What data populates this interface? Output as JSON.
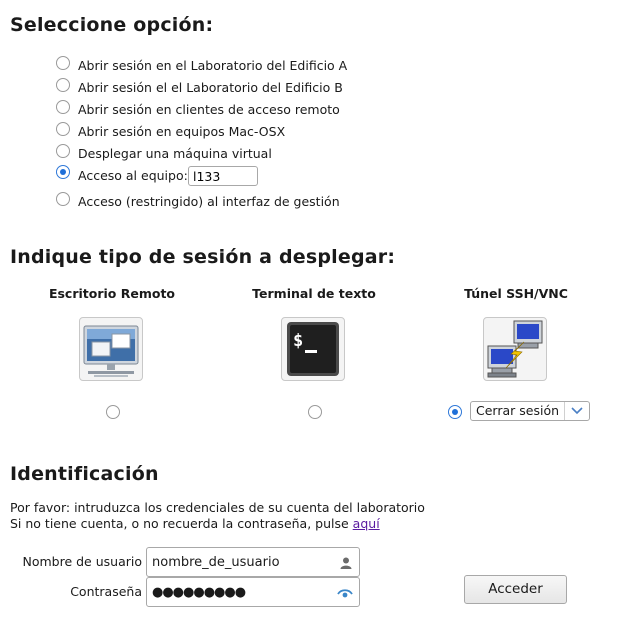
{
  "option_section": {
    "title": "Seleccione opción:",
    "options": [
      {
        "label": "Abrir sesión en el Laboratorio del Edificio A",
        "checked": false
      },
      {
        "label": "Abrir sesión el el Laboratorio del Edificio B",
        "checked": false
      },
      {
        "label": "Abrir sesión en clientes de acceso remoto",
        "checked": false
      },
      {
        "label": "Abrir sesión en equipos Mac-OSX",
        "checked": false
      },
      {
        "label": "Desplegar una máquina virtual",
        "checked": false
      },
      {
        "label": "Acceso al equipo:",
        "checked": true
      },
      {
        "label": "Acceso (restringido) al interfaz de gestión",
        "checked": false
      }
    ],
    "equipo_value": "l133"
  },
  "session_section": {
    "title": "Indique tipo de sesión a desplegar:",
    "types": [
      {
        "label": "Escritorio Remoto",
        "icon": "remote-desktop-icon",
        "checked": false
      },
      {
        "label": "Terminal de texto",
        "icon": "terminal-icon",
        "checked": false
      },
      {
        "label": "Túnel SSH/VNC",
        "icon": "ssh-tunnel-icon",
        "checked": true
      }
    ],
    "close_select": "Cerrar sesión"
  },
  "identification": {
    "title": "Identificación",
    "line1": "Por favor: intruduzca los credenciales de su cuenta del laboratorio",
    "line2_prefix": "Si no tiene cuenta, o no recuerda la contraseña, pulse ",
    "line2_link": "aquí",
    "username_label": "Nombre de usuario",
    "username_value": "nombre_de_usuario",
    "password_label": "Contraseña",
    "password_value": "●●●●●●●●●",
    "submit_label": "Acceder"
  },
  "colors": {
    "accent": "#1f6fd8",
    "link": "#5a1aa0"
  }
}
